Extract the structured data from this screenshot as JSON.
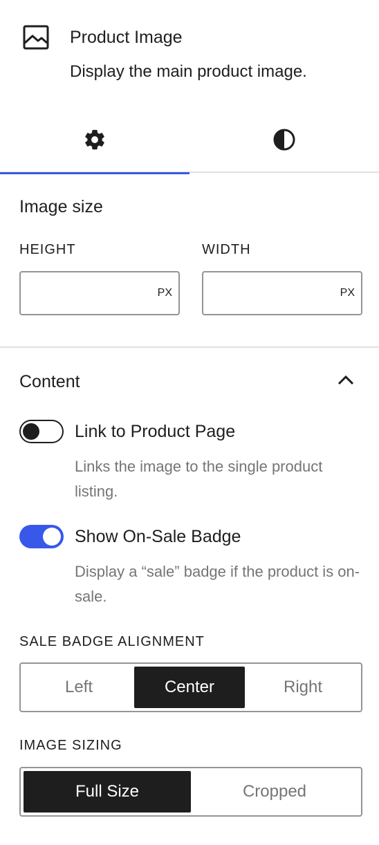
{
  "block": {
    "icon": "image-icon",
    "title": "Product Image",
    "description": "Display the main product image."
  },
  "tabs": [
    {
      "name": "settings",
      "icon": "gear-icon",
      "active": true
    },
    {
      "name": "styles",
      "icon": "contrast-icon",
      "active": false
    }
  ],
  "accent_color": "#3858e9",
  "image_size": {
    "title": "Image size",
    "height": {
      "label": "HEIGHT",
      "value": "",
      "unit": "PX"
    },
    "width": {
      "label": "WIDTH",
      "value": "",
      "unit": "PX"
    }
  },
  "content": {
    "title": "Content",
    "collapse_icon": "chevron-up-icon",
    "link_toggle": {
      "label": "Link to Product Page",
      "help": "Links the image to the single product listing.",
      "checked": false
    },
    "sale_toggle": {
      "label": "Show On-Sale Badge",
      "help": "Display a “sale” badge if the product is on-sale.",
      "checked": true
    },
    "badge_alignment": {
      "label": "SALE BADGE ALIGNMENT",
      "options": [
        "Left",
        "Center",
        "Right"
      ],
      "selected": "Center"
    },
    "image_sizing": {
      "label": "IMAGE SIZING",
      "options": [
        "Full Size",
        "Cropped"
      ],
      "selected": "Full Size"
    }
  }
}
